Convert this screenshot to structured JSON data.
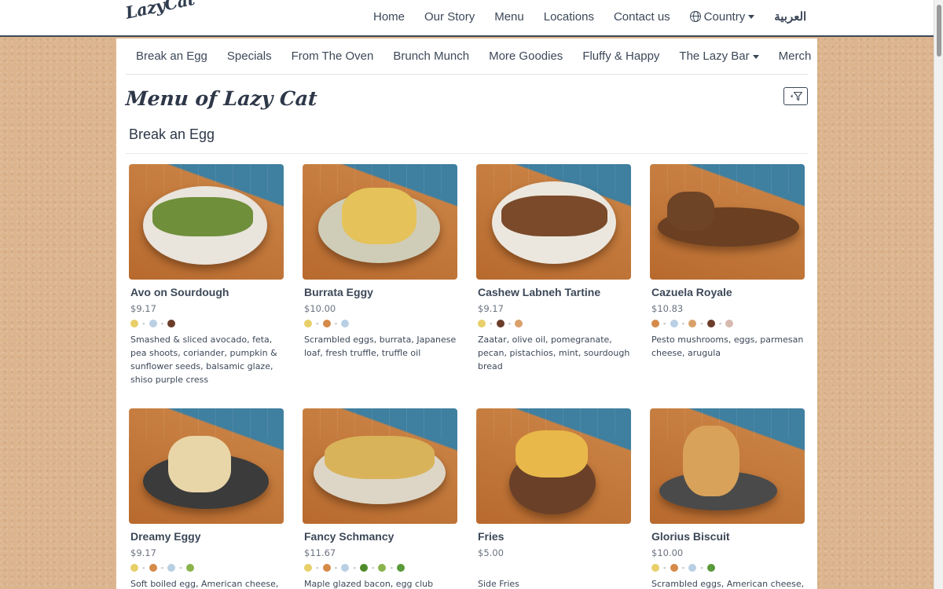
{
  "header": {
    "logo": "LazyCat",
    "nav": [
      {
        "label": "Home"
      },
      {
        "label": "Our Story"
      },
      {
        "label": "Menu"
      },
      {
        "label": "Locations"
      },
      {
        "label": "Contact us"
      },
      {
        "label": "Country",
        "icon": "globe-icon",
        "dropdown": true
      },
      {
        "label": "العربية"
      }
    ]
  },
  "category_nav": [
    {
      "label": "Break an Egg"
    },
    {
      "label": "Specials"
    },
    {
      "label": "From The Oven"
    },
    {
      "label": "Brunch Munch"
    },
    {
      "label": "More Goodies"
    },
    {
      "label": "Fluffy & Happy"
    },
    {
      "label": "The Lazy Bar",
      "dropdown": true
    },
    {
      "label": "Merch"
    }
  ],
  "page_title": "Menu of Lazy Cat",
  "filter_icon": "filter-icon",
  "section": {
    "title": "Break an Egg",
    "items": [
      {
        "name": "Avo on Sourdough",
        "price": "$9.17",
        "allergens": [
          "gluten",
          "dairy",
          "nuts"
        ],
        "description": "Smashed & sliced avocado, feta, pea shoots, coriander, pumpkin & sunflower seeds, balsamic glaze, shiso purple cress"
      },
      {
        "name": "Burrata Eggy",
        "price": "$10.00",
        "allergens": [
          "gluten",
          "egg",
          "dairy"
        ],
        "description": "Scrambled eggs, burrata, Japanese loaf, fresh truffle, truffle oil"
      },
      {
        "name": "Cashew Labneh Tartine",
        "price": "$9.17",
        "allergens": [
          "gluten",
          "nuts",
          "peanut"
        ],
        "description": "Zaatar, olive oil, pomegranate, pecan, pistachios, mint, sourdough bread"
      },
      {
        "name": "Cazuela Royale",
        "price": "$10.83",
        "allergens": [
          "egg",
          "dairy",
          "peanut",
          "nuts",
          "garlic"
        ],
        "description": "Pesto mushrooms, eggs, parmesan cheese, arugula"
      },
      {
        "name": "Dreamy Eggy",
        "price": "$9.17",
        "allergens": [
          "gluten",
          "egg",
          "dairy",
          "herb"
        ],
        "description": "Soft boiled egg, American cheese,"
      },
      {
        "name": "Fancy Schmancy",
        "price": "$11.67",
        "allergens": [
          "gluten",
          "egg",
          "dairy",
          "sprout",
          "herb",
          "leaf"
        ],
        "description": "Maple glazed bacon, egg club"
      },
      {
        "name": "Fries",
        "price": "$5.00",
        "allergens": [],
        "description": "Side Fries"
      },
      {
        "name": "Glorius Biscuit",
        "price": "$10.00",
        "allergens": [
          "gluten",
          "egg",
          "dairy",
          "leaf"
        ],
        "description": "Scrambled eggs, American cheese,"
      }
    ]
  },
  "allergen_colors": {
    "gluten": "#e8cf6a",
    "egg": "#d58a4a",
    "dairy": "#b9cfe4",
    "nuts": "#6b3d2a",
    "peanut": "#d9a06b",
    "garlic": "#d8b9b0",
    "herb": "#8bb34d",
    "sprout": "#4e8a2c",
    "leaf": "#5a9a3a"
  },
  "colors": {
    "navy": "#3c4858",
    "background": "#dcb58f"
  }
}
